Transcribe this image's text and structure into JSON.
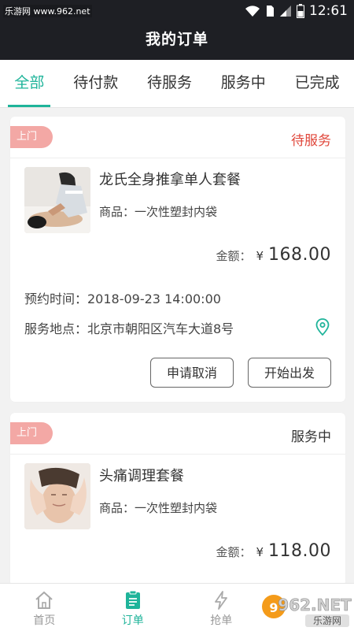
{
  "status_bar": {
    "watermark": "乐游网 www.962.net",
    "time": "12:61"
  },
  "header": {
    "title": "我的订单"
  },
  "tabs": [
    {
      "label": "全部",
      "active": true
    },
    {
      "label": "待付款",
      "active": false
    },
    {
      "label": "待服务",
      "active": false
    },
    {
      "label": "服务中",
      "active": false
    },
    {
      "label": "已完成",
      "active": false
    }
  ],
  "orders": [
    {
      "badge": "上门",
      "status": "待服务",
      "status_color": "#e0473b",
      "product_name": "龙氏全身推拿单人套餐",
      "goods": "商品：一次性塑封内袋",
      "amount_label": "金额：",
      "currency": "¥",
      "amount": "168.00",
      "appointment": "预约时间：2018-09-23 14:00:00",
      "location": "服务地点：北京市朝阳区汽车大道8号",
      "btn_cancel": "申请取消",
      "btn_start": "开始出发"
    },
    {
      "badge": "上门",
      "status": "服务中",
      "status_color": "#333333",
      "product_name": "头痛调理套餐",
      "goods": "商品：一次性塑封内袋",
      "amount_label": "金额：",
      "currency": "¥",
      "amount": "118.00"
    }
  ],
  "bottom_nav": [
    {
      "label": "首页",
      "icon": "home-icon",
      "active": false
    },
    {
      "label": "订单",
      "icon": "order-list-icon",
      "active": true
    },
    {
      "label": "抢单",
      "icon": "lightning-icon",
      "active": false
    }
  ],
  "watermark_logo": {
    "text": "962.NET",
    "sub": "乐游网"
  },
  "colors": {
    "accent": "#1fb49a",
    "header_bg": "#1e1f24",
    "badge_bg": "#f3a8a5",
    "status_red": "#e0473b"
  }
}
